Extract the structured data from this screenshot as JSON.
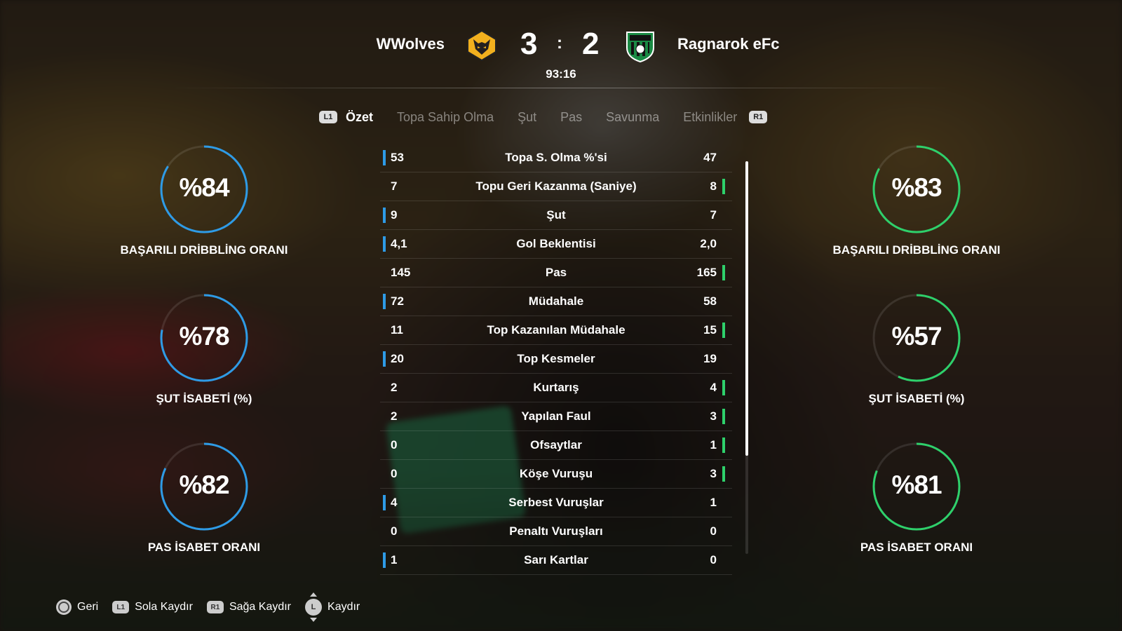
{
  "match": {
    "home_team": "WWolves",
    "away_team": "Ragnarok eFc",
    "home_score": "3",
    "away_score": "2",
    "separator": ":",
    "clock": "93:16",
    "home_color": "#2e9be6",
    "away_color": "#2ed06b"
  },
  "tabs": {
    "left_shoulder": "L1",
    "right_shoulder": "R1",
    "items": [
      "Özet",
      "Topa Sahip Olma",
      "Şut",
      "Pas",
      "Savunma",
      "Etkinlikler"
    ],
    "active": "Özet"
  },
  "home_gauges": [
    {
      "value": "%84",
      "percent": 84,
      "label": "BAŞARILI DRİBBLİNG ORANI"
    },
    {
      "value": "%78",
      "percent": 78,
      "label": "ŞUT İSABETİ (%)"
    },
    {
      "value": "%82",
      "percent": 82,
      "label": "PAS İSABET ORANI"
    }
  ],
  "away_gauges": [
    {
      "value": "%83",
      "percent": 83,
      "label": "BAŞARILI DRİBBLİNG ORANI"
    },
    {
      "value": "%57",
      "percent": 57,
      "label": "ŞUT İSABETİ (%)"
    },
    {
      "value": "%81",
      "percent": 81,
      "label": "PAS İSABET ORANI"
    }
  ],
  "stats": [
    {
      "name": "Topa S. Olma %'si",
      "home": "53",
      "away": "47",
      "leader": "home"
    },
    {
      "name": "Topu Geri Kazanma (Saniye)",
      "home": "7",
      "away": "8",
      "leader": "away"
    },
    {
      "name": "Şut",
      "home": "9",
      "away": "7",
      "leader": "home"
    },
    {
      "name": "Gol Beklentisi",
      "home": "4,1",
      "away": "2,0",
      "leader": "home"
    },
    {
      "name": "Pas",
      "home": "145",
      "away": "165",
      "leader": "away"
    },
    {
      "name": "Müdahale",
      "home": "72",
      "away": "58",
      "leader": "home"
    },
    {
      "name": "Top Kazanılan Müdahale",
      "home": "11",
      "away": "15",
      "leader": "away"
    },
    {
      "name": "Top Kesmeler",
      "home": "20",
      "away": "19",
      "leader": "home"
    },
    {
      "name": "Kurtarış",
      "home": "2",
      "away": "4",
      "leader": "away"
    },
    {
      "name": "Yapılan Faul",
      "home": "2",
      "away": "3",
      "leader": "away"
    },
    {
      "name": "Ofsaytlar",
      "home": "0",
      "away": "1",
      "leader": "away"
    },
    {
      "name": "Köşe Vuruşu",
      "home": "0",
      "away": "3",
      "leader": "away"
    },
    {
      "name": "Serbest Vuruşlar",
      "home": "4",
      "away": "1",
      "leader": "home"
    },
    {
      "name": "Penaltı Vuruşları",
      "home": "0",
      "away": "0",
      "leader": "none"
    },
    {
      "name": "Sarı Kartlar",
      "home": "1",
      "away": "0",
      "leader": "home"
    }
  ],
  "footer": {
    "back": {
      "button": "circle-button-icon",
      "label": "Geri"
    },
    "left": {
      "button": "L1",
      "label": "Sola Kaydır"
    },
    "right": {
      "button": "R1",
      "label": "Sağa Kaydır"
    },
    "scroll": {
      "button": "L",
      "label": "Kaydır"
    }
  }
}
